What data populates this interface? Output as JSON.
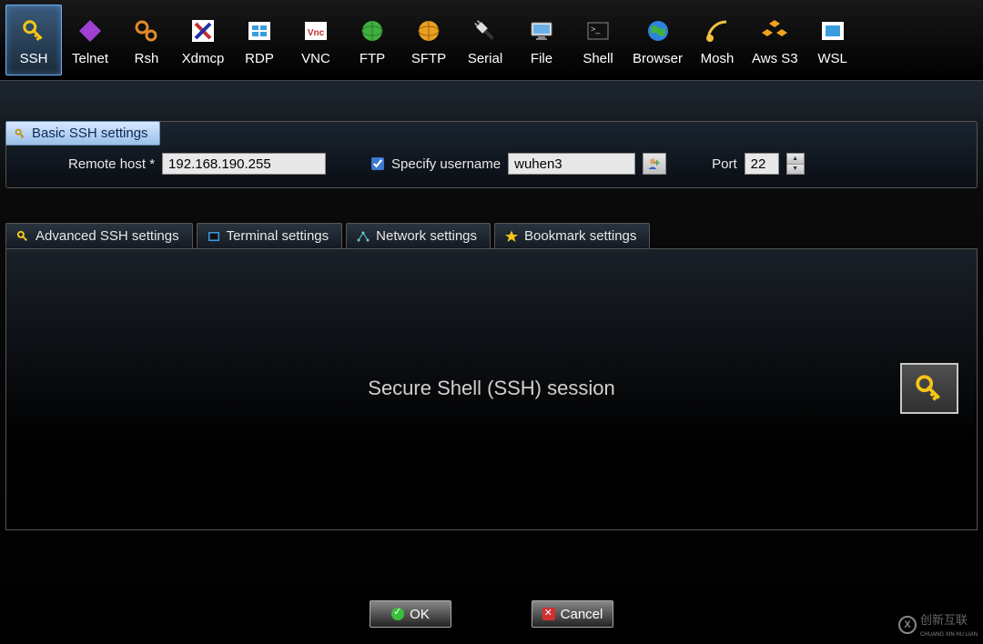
{
  "toolbar": {
    "items": [
      {
        "id": "ssh",
        "label": "SSH",
        "selected": true
      },
      {
        "id": "telnet",
        "label": "Telnet"
      },
      {
        "id": "rsh",
        "label": "Rsh"
      },
      {
        "id": "xdmcp",
        "label": "Xdmcp"
      },
      {
        "id": "rdp",
        "label": "RDP"
      },
      {
        "id": "vnc",
        "label": "VNC"
      },
      {
        "id": "ftp",
        "label": "FTP"
      },
      {
        "id": "sftp",
        "label": "SFTP"
      },
      {
        "id": "serial",
        "label": "Serial"
      },
      {
        "id": "file",
        "label": "File"
      },
      {
        "id": "shell",
        "label": "Shell"
      },
      {
        "id": "browser",
        "label": "Browser"
      },
      {
        "id": "mosh",
        "label": "Mosh"
      },
      {
        "id": "awss3",
        "label": "Aws S3"
      },
      {
        "id": "wsl",
        "label": "WSL"
      }
    ]
  },
  "basic": {
    "header": "Basic SSH settings",
    "remote_host_label": "Remote host *",
    "remote_host_value": "192.168.190.255",
    "specify_username_label": "Specify username",
    "specify_username_checked": true,
    "username_value": "wuhen3",
    "port_label": "Port",
    "port_value": "22"
  },
  "tabs": {
    "items": [
      {
        "id": "adv",
        "label": "Advanced SSH settings"
      },
      {
        "id": "term",
        "label": "Terminal settings"
      },
      {
        "id": "net",
        "label": "Network settings"
      },
      {
        "id": "bookmark",
        "label": "Bookmark settings"
      }
    ],
    "panel_title": "Secure Shell (SSH) session"
  },
  "footer": {
    "ok": "OK",
    "cancel": "Cancel"
  },
  "watermark": {
    "brand": "创新互联",
    "sub": "CHUANG XIN HU LIAN"
  }
}
